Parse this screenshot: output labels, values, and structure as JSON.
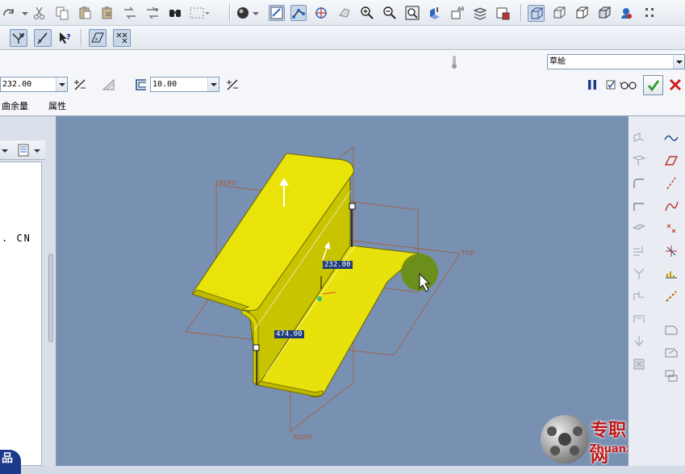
{
  "dashboard": {
    "sketch_dropdown_value": "草絵",
    "bend_radius_value": "232.00",
    "thickness_value": "10.00",
    "tabs": [
      "曲余量",
      "属性"
    ]
  },
  "viewport": {
    "dimension_labels": [
      "232.00",
      "474.00"
    ],
    "datum_planes": [
      "FRONT",
      "TOP",
      "RIGHT"
    ],
    "model_color": "#e6e000",
    "background_color": "#7891b3"
  },
  "left_panel": {
    "fragment_text": ". CN",
    "watermark_partial": "品"
  },
  "watermark": {
    "brand_cn": "专职网",
    "brand_url": "Zhuanzhi.Net"
  },
  "colors": {
    "accent_green": "#2e9d2e",
    "cancel_red": "#d01818",
    "pause_blue": "#1b3d8a"
  },
  "icons": {
    "toolbar_row1": [
      "redo-icon",
      "cut-icon",
      "copy-icon",
      "paste-icon",
      "paste-special-icon",
      "regenerate-icon",
      "regen-manager-icon",
      "find-icon",
      "select-box-icon",
      "shading-icon",
      "repaint-icon",
      "spin-center-icon",
      "orient-icon",
      "saved-views-icon",
      "zoom-in-icon",
      "zoom-out-icon",
      "refit-icon",
      "layers-icon",
      "display-style-icon",
      "wireframe-icon",
      "hidden-line-icon",
      "no-hidden-icon",
      "shaded-icon",
      "model-tree-icon",
      "settings-icon"
    ],
    "toolbar_row2": [
      "datum-axis-toggle-icon",
      "datum-point-toggle-icon",
      "whats-this-icon",
      "datum-plane-toggle-icon",
      "csys-toggle-icon"
    ]
  }
}
